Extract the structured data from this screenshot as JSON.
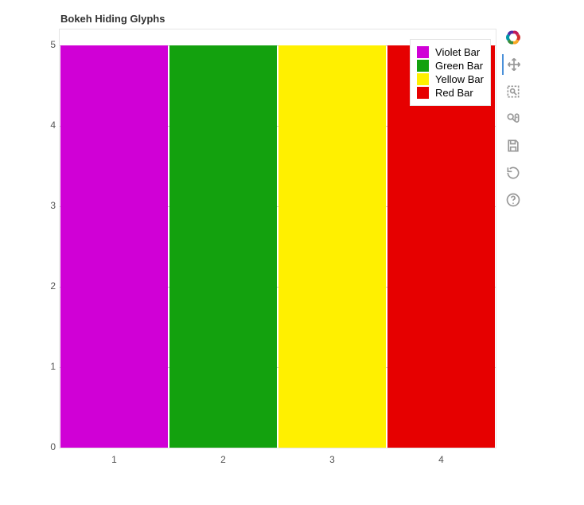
{
  "title": "Bokeh Hiding Glyphs",
  "chart_data": {
    "type": "bar",
    "categories": [
      1,
      2,
      3,
      4
    ],
    "series": [
      {
        "name": "Violet Bar",
        "color": "#d000d6",
        "x": 1,
        "value": 5
      },
      {
        "name": "Green Bar",
        "color": "#13a10e",
        "x": 2,
        "value": 5
      },
      {
        "name": "Yellow Bar",
        "color": "#fff000",
        "x": 3,
        "value": 5
      },
      {
        "name": "Red Bar",
        "color": "#e60000",
        "x": 4,
        "value": 5
      }
    ],
    "x_ticks": [
      1,
      2,
      3,
      4
    ],
    "y_ticks": [
      0,
      1,
      2,
      3,
      4,
      5
    ],
    "xlim": [
      0.5,
      4.5
    ],
    "ylim": [
      0,
      5.2
    ],
    "title": "Bokeh Hiding Glyphs",
    "xlabel": "",
    "ylabel": "",
    "grid": true,
    "legend_position": "top_right"
  },
  "legend": {
    "items": [
      {
        "label": "Violet Bar"
      },
      {
        "label": "Green Bar"
      },
      {
        "label": "Yellow Bar"
      },
      {
        "label": "Red Bar"
      }
    ]
  },
  "toolbar": {
    "items": [
      {
        "name": "bokeh-logo-icon"
      },
      {
        "name": "pan-icon"
      },
      {
        "name": "box-zoom-icon"
      },
      {
        "name": "wheel-zoom-icon"
      },
      {
        "name": "save-icon"
      },
      {
        "name": "reset-icon"
      },
      {
        "name": "help-icon"
      }
    ]
  }
}
